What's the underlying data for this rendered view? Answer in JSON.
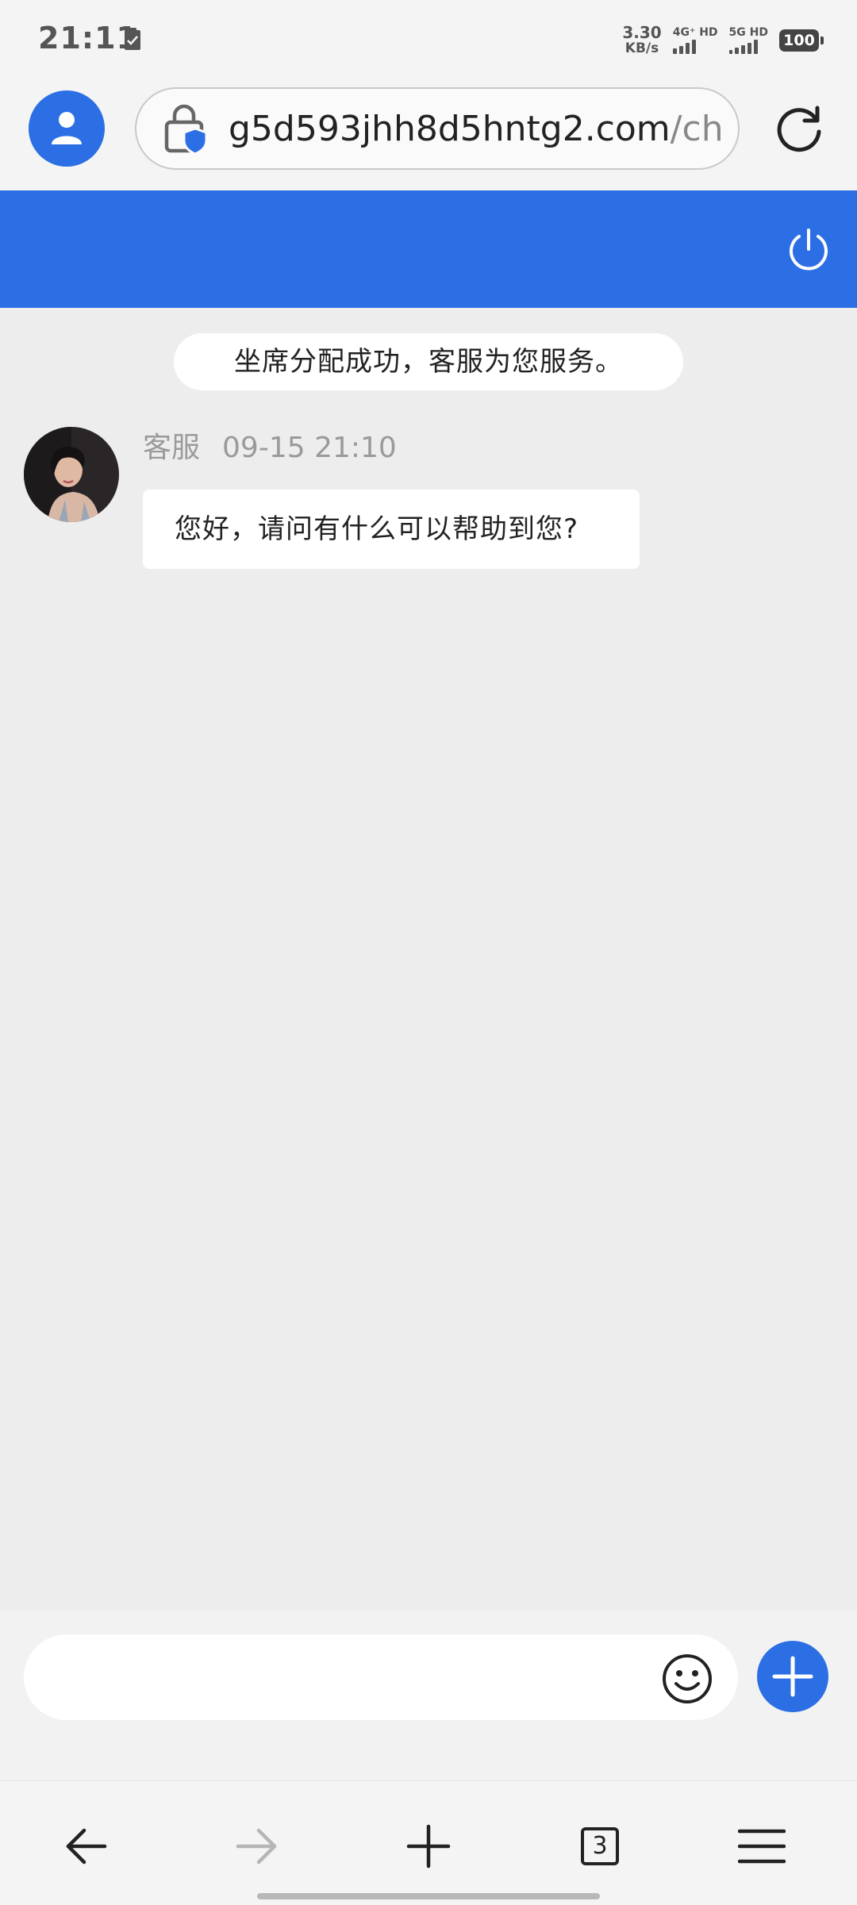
{
  "status_bar": {
    "time": "21:11",
    "net_speed_value": "3.30",
    "net_speed_unit": "KB/s",
    "sim1_label": "4G⁺ HD",
    "sim2_label": "5G HD",
    "battery_level": "100"
  },
  "browser": {
    "url_host": "g5d593jhh8d5hntg2.com",
    "url_path": "/chat/i",
    "open_tab_count": "3"
  },
  "chat": {
    "system_notice": "坐席分配成功，客服为您服务。",
    "messages": [
      {
        "sender": "客服",
        "time": "09-15 21:10",
        "text": "您好，请问有什么可以帮助到您?"
      }
    ]
  },
  "input": {
    "placeholder": ""
  },
  "colors": {
    "accent": "#2c6fe4",
    "chat_background": "#ededed",
    "bubble_background": "#ffffff"
  }
}
